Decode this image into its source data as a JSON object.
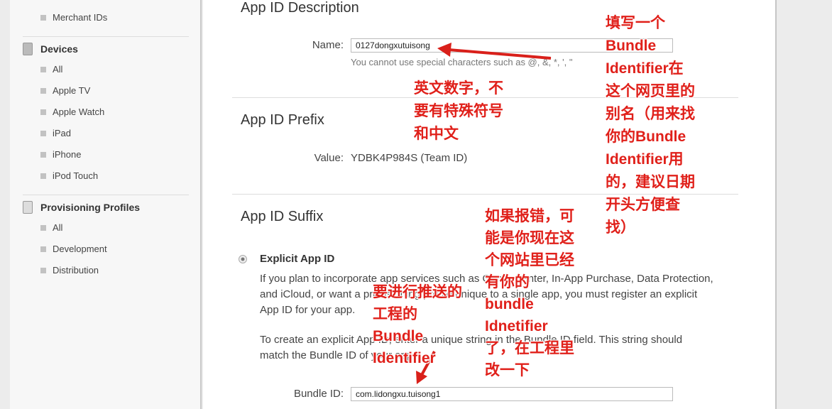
{
  "sidebar": {
    "merchant_ids": "Merchant IDs",
    "devices": {
      "title": "Devices",
      "items": [
        "All",
        "Apple TV",
        "Apple Watch",
        "iPad",
        "iPhone",
        "iPod Touch"
      ]
    },
    "profiles": {
      "title": "Provisioning Profiles",
      "items": [
        "All",
        "Development",
        "Distribution"
      ]
    }
  },
  "main": {
    "description": {
      "title": "App ID Description",
      "name_label": "Name:",
      "name_value": "0127dongxutuisong",
      "hint": "You cannot use special characters such as @, &, *, ', \""
    },
    "prefix": {
      "title": "App ID Prefix",
      "value_label": "Value:",
      "value": "YDBK4P984S (Team ID)"
    },
    "suffix": {
      "title": "App ID Suffix",
      "explicit_label": "Explicit App ID",
      "para1": "If you plan to incorporate app services such as Game Center, In-App Purchase, Data Protection, and iCloud, or want a provisioning profile unique to a single app, you must register an explicit App ID for your app.",
      "para2": "To create an explicit App ID, enter a unique string in the Bundle ID field. This string should match the Bundle ID of your app.",
      "bundle_label": "Bundle ID:",
      "bundle_value": "com.lidongxu.tuisong1"
    }
  },
  "annotations": {
    "a1": "填写一个\nBundle\nIdentifier在\n这个网页里的\n别名（用来找\n你的Bundle\nIdentifier用\n的，建议日期\n开头方便查\n找）",
    "a2": "英文数字，不\n要有特殊符号\n和中文",
    "a3": "如果报错，可\n能是你现在这\n个网站里已经\n有你的\nbundle\nIdnetifier\n了，在工程里\n改一下",
    "a4": "要进行推送的\n工程的\nBundle\nIdentifier",
    "color": "#e0201a"
  }
}
